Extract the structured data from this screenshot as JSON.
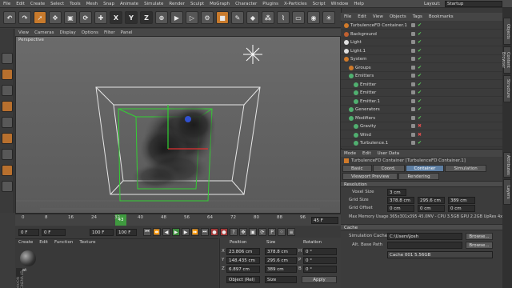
{
  "menu": [
    "File",
    "Edit",
    "Create",
    "Select",
    "Tools",
    "Mesh",
    "Snap",
    "Animate",
    "Simulate",
    "Render",
    "Sculpt",
    "MoGraph",
    "Character",
    "Plugins",
    "X-Particles",
    "Script",
    "Window",
    "Help"
  ],
  "layout": {
    "label": "Layout:",
    "value": "Startup"
  },
  "toolbar": {
    "axis_x": "X",
    "axis_y": "Y",
    "axis_z": "Z"
  },
  "viewport": {
    "menu": [
      "View",
      "Cameras",
      "Display",
      "Options",
      "Filter",
      "Panel"
    ],
    "label": "Perspective"
  },
  "timeline": {
    "ticks": [
      "0",
      "8",
      "16",
      "24",
      "32",
      "40",
      "48",
      "56",
      "64",
      "72",
      "80",
      "88",
      "96"
    ],
    "current_frame_marker": "43",
    "end_field": "45 F",
    "start_field": "0 F",
    "field2": "0 F",
    "max_field": "100 F",
    "field4": "100 F"
  },
  "material": {
    "menu": [
      "Create",
      "Edit",
      "Function",
      "Texture"
    ],
    "mat_name": "Mat"
  },
  "coords": {
    "headers": {
      "position": "Position",
      "size": "Size",
      "rotation": "Rotation"
    },
    "rows": [
      {
        "axis": "X",
        "pos": "23.806 cm",
        "size": "378.8 cm",
        "rot_axis": "H",
        "rot": "0 °"
      },
      {
        "axis": "Y",
        "pos": "148.435 cm",
        "size": "295.6 cm",
        "rot_axis": "P",
        "rot": "0 °"
      },
      {
        "axis": "Z",
        "pos": "6.897 cm",
        "size": "389 cm",
        "rot_axis": "B",
        "rot": "0 °"
      }
    ],
    "mode": "Object (Rel)",
    "size_mode": "Size",
    "apply": "Apply"
  },
  "objects": {
    "menu": [
      "File",
      "Edit",
      "View",
      "Objects",
      "Tags",
      "Bookmarks"
    ],
    "rows": [
      {
        "name": "TurbulenceFD Container.1",
        "indent": 0,
        "tick": true,
        "icon": "#d07a2a"
      },
      {
        "name": "Background",
        "indent": 0,
        "tick": true,
        "icon": "#c06030"
      },
      {
        "name": "Light",
        "indent": 0,
        "tick": true,
        "icon": "#e0e0e0"
      },
      {
        "name": "Light.1",
        "indent": 0,
        "tick": true,
        "icon": "#e0e0e0"
      },
      {
        "name": "System",
        "indent": 0,
        "tick": true,
        "icon": "#d07a2a"
      },
      {
        "name": "Groups",
        "indent": 1,
        "tick": true,
        "icon": "#d07a2a"
      },
      {
        "name": "Emitters",
        "indent": 1,
        "tick": true,
        "icon": "#50b070"
      },
      {
        "name": "Emitter",
        "indent": 2,
        "tick": true,
        "icon": "#50b070"
      },
      {
        "name": "Emitter",
        "indent": 2,
        "tick": true,
        "icon": "#50b070"
      },
      {
        "name": "Emitter.1",
        "indent": 2,
        "tick": true,
        "icon": "#50b070"
      },
      {
        "name": "Generators",
        "indent": 1,
        "tick": true,
        "icon": "#50b070"
      },
      {
        "name": "Modifiers",
        "indent": 1,
        "tick": true,
        "icon": "#50b070"
      },
      {
        "name": "Gravity",
        "indent": 2,
        "tick": false,
        "icon": "#50b070"
      },
      {
        "name": "Wind",
        "indent": 2,
        "tick": false,
        "icon": "#50b070"
      },
      {
        "name": "Turbulence.1",
        "indent": 2,
        "tick": true,
        "icon": "#50b070"
      }
    ]
  },
  "attributes": {
    "menu": [
      "Mode",
      "Edit",
      "User Data"
    ],
    "title": "TurbulenceFD Container [TurbulenceFD Container.1]",
    "tabs": [
      "Basic",
      "Coord.",
      "Container",
      "Simulation"
    ],
    "tabs2": [
      "Viewport Preview",
      "Rendering"
    ],
    "section_resolution": "Resolution",
    "voxel_size_label": "Voxel Size",
    "voxel_size": "3 cm",
    "grid_size_label": "Grid Size",
    "grid_size": [
      "378.8 cm",
      "295.6 cm",
      "389 cm"
    ],
    "grid_offset_label": "Grid Offset",
    "grid_offset": [
      "0 cm",
      "0 cm",
      "0 cm"
    ],
    "max_mem": "Max Memory Usage 365x301x395 45.0MV - CPU 3.5GB GPU 2.2GB UpRes 4x",
    "section_cache": "Cache",
    "sim_cache_label": "Simulation Cache",
    "sim_cache_path": "C:\\Users\\Josh Johnson\\Turbulence",
    "alt_base_label": "Alt. Base Path",
    "browse": "Browse...",
    "cache_info": "Cache 001 5.56GB"
  },
  "vtabs": [
    "Objects",
    "Content Browser",
    "Structure"
  ],
  "vtabs2": [
    "Attributes",
    "Layers"
  ],
  "logo": "MAXON CINEMA 4D"
}
